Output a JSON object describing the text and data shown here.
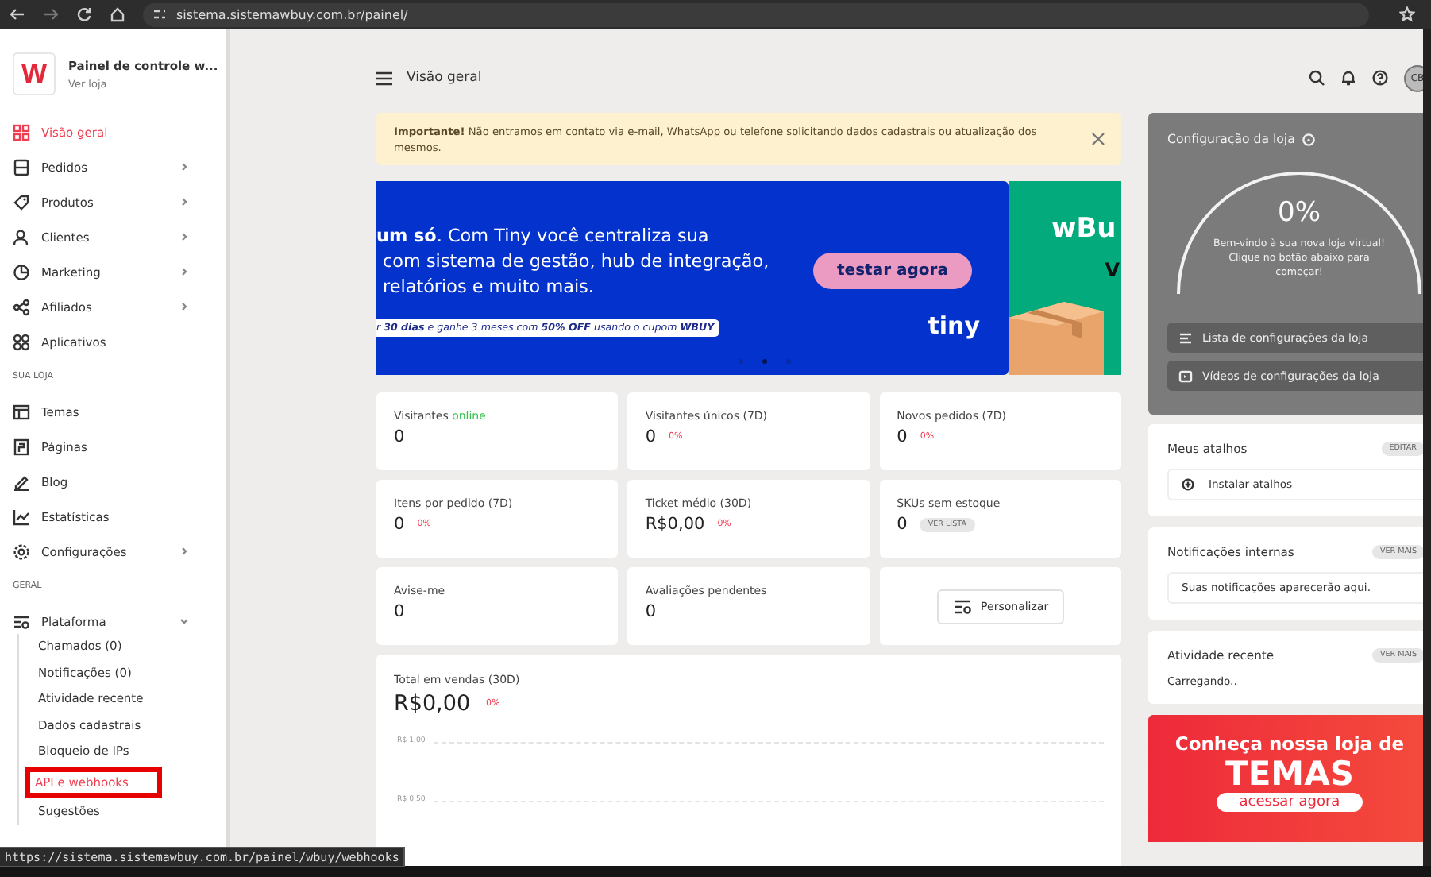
{
  "browser": {
    "url": "sistema.sistemawbuy.com.br/painel/"
  },
  "sidebar": {
    "logo_text": "W",
    "store_title": "Painel de controle w...",
    "store_link": "Ver loja",
    "sections": [
      {
        "items": [
          {
            "kind": "link",
            "label": "Visão geral",
            "selected": true
          },
          {
            "kind": "group",
            "label": "Pedidos",
            "selected": false,
            "expanded": false
          },
          {
            "kind": "group",
            "label": "Produtos",
            "selected": false,
            "expanded": false
          },
          {
            "kind": "group",
            "label": "Clientes",
            "selected": false,
            "expanded": false
          },
          {
            "kind": "group",
            "label": "Marketing",
            "selected": false,
            "expanded": false
          },
          {
            "kind": "group",
            "label": "Afiliados",
            "selected": false,
            "expanded": false
          },
          {
            "kind": "link",
            "label": "Aplicativos",
            "selected": false
          }
        ]
      },
      {
        "heading": "SUA LOJA",
        "items": [
          {
            "kind": "link",
            "label": "Temas",
            "selected": false
          },
          {
            "kind": "link",
            "label": "Páginas",
            "selected": false
          },
          {
            "kind": "link",
            "label": "Blog",
            "selected": false
          },
          {
            "kind": "link",
            "label": "Estatísticas",
            "selected": false
          },
          {
            "kind": "group",
            "label": "Configurações",
            "selected": false,
            "expanded": false
          }
        ]
      },
      {
        "heading": "GERAL",
        "items": [
          {
            "kind": "group",
            "label": "Plataforma",
            "selected": false,
            "expanded": true,
            "children": [
              {
                "label": "Chamados (0)",
                "selected": false,
                "highlighted": false
              },
              {
                "label": "Notificações (0)",
                "selected": false,
                "highlighted": false
              },
              {
                "label": "Atividade recente",
                "selected": false,
                "highlighted": false
              },
              {
                "label": "Dados cadastrais",
                "selected": false,
                "highlighted": false
              },
              {
                "label": "Bloqueio de IPs",
                "selected": false,
                "highlighted": false
              },
              {
                "label": "API e webhooks",
                "selected": true,
                "highlighted": true
              },
              {
                "label": "Sugestões",
                "selected": false,
                "highlighted": false
              }
            ]
          }
        ]
      }
    ]
  },
  "header": {
    "title": "Visão geral",
    "avatar_initials": "CB"
  },
  "alert": {
    "text": "**Importante!** Não entramos em contato via e-mail, WhatsApp ou telefone solicitando dados cadastrais ou atualização dos mesmos."
  },
  "banner": {
    "text_lines": [
      "**um só**. Com Tiny você centraliza sua",
      "com sistema de gestão, hub de integração,",
      "relatórios e muito mais."
    ],
    "promo": "r **30 dias** e ganhe 3 meses com **50% OFF** usando o cupom **WBUY**",
    "button": "testar agora",
    "brand": "tiny",
    "next_slide_title": "wBu",
    "next_slide_letter": "V",
    "dots": [
      {
        "selected": false
      },
      {
        "selected": true
      },
      {
        "selected": false
      }
    ]
  },
  "stats": [
    {
      "kind": "metric",
      "label": "Visitantes",
      "label_accent": "online",
      "value": "0"
    },
    {
      "kind": "metric",
      "label": "Visitantes únicos (7D)",
      "value": "0",
      "change": "0%"
    },
    {
      "kind": "metric",
      "label": "Novos pedidos (7D)",
      "value": "0",
      "change": "0%"
    },
    {
      "kind": "metric",
      "label": "Itens por pedido (7D)",
      "value": "0",
      "change": "0%"
    },
    {
      "kind": "metric",
      "label": "Ticket médio (30D)",
      "value": "R$0,00",
      "change": "0%"
    },
    {
      "kind": "metric",
      "label": "SKUs sem estoque",
      "value": "0",
      "action": "VER LISTA"
    },
    {
      "kind": "metric",
      "label": "Avise-me",
      "value": "0"
    },
    {
      "kind": "metric",
      "label": "Avaliações pendentes",
      "value": "0"
    },
    {
      "kind": "button",
      "label": "Personalizar"
    }
  ],
  "sales": {
    "label": "Total em vendas (30D)",
    "value": "R$0,00",
    "change": "0%",
    "axis_labels": [
      "R$ 1,00",
      "R$ 0,50"
    ]
  },
  "setup": {
    "title": "Configuração da loja",
    "progress": "0%",
    "message": "Bem-vindo à sua nova loja virtual! Clique no botão abaixo para começar!",
    "links": [
      "Lista de configurações da loja",
      "Vídeos de configurações da loja"
    ]
  },
  "shortcuts": {
    "title": "Meus atalhos",
    "action": "EDITAR",
    "items": [
      "Instalar atalhos"
    ]
  },
  "notifications": {
    "title": "Notificações internas",
    "action": "VER MAIS",
    "empty_text": "Suas notificações aparecerão aqui."
  },
  "activity": {
    "title": "Atividade recente",
    "action": "VER MAIS",
    "text": "Carregando.."
  },
  "themes_banner": {
    "line1": "Conheça nossa loja de",
    "line2": "TEMAS",
    "button": "acessar agora"
  },
  "status_url": "https://sistema.sistemawbuy.com.br/painel/wbuy/webhooks"
}
